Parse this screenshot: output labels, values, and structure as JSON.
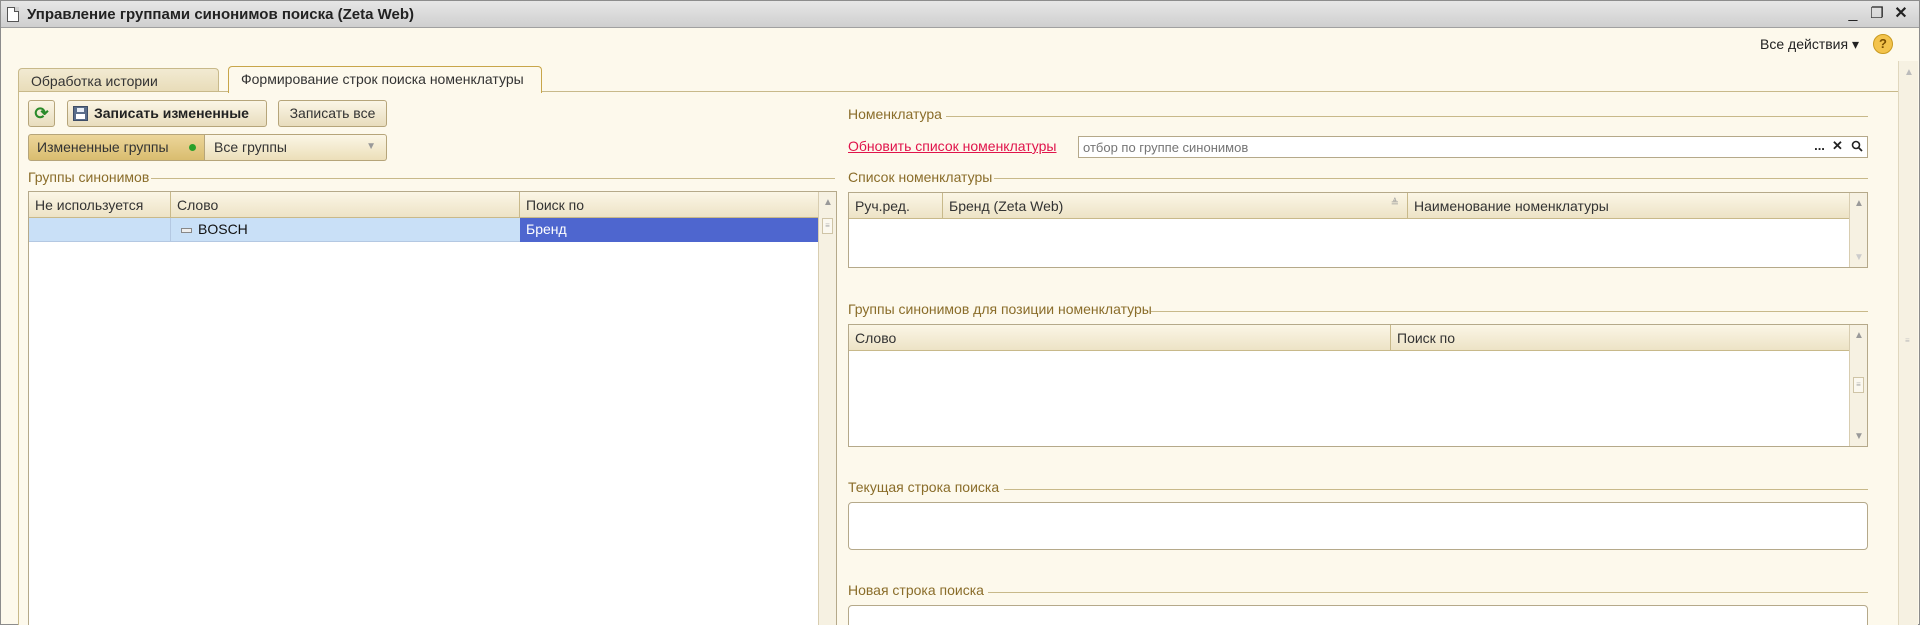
{
  "window": {
    "title": "Управление группами синонимов поиска (Zeta Web)",
    "controls": {
      "minimize": "_",
      "restore": "❐",
      "close": "✕"
    }
  },
  "toolbar": {
    "all_actions": "Все действия ▾",
    "help": "?"
  },
  "tabs": [
    {
      "label": "Обработка истории поиска",
      "active": false
    },
    {
      "label": "Формирование строк поиска номенклатуры",
      "active": true
    }
  ],
  "left": {
    "refresh_icon": "refresh-icon",
    "save_changed_label": "Записать измененные",
    "save_all_label": "Записать все",
    "filter_changed": "Измененные группы",
    "filter_all": "Все группы",
    "synonym_groups_title": "Группы синонимов",
    "grid": {
      "columns": [
        "Не используется",
        "Слово",
        "Поиск по"
      ],
      "rows": [
        {
          "unused": "",
          "word": "BOSCH",
          "search_by": "Бренд"
        }
      ]
    }
  },
  "right": {
    "nomenclature_title": "Номенклатура",
    "refresh_link": "Обновить список номенклатуры",
    "filter_placeholder": "отбор по группе синонимов",
    "input_buttons": {
      "choose": "...",
      "clear": "✕",
      "search": "search-icon"
    },
    "nomenclature_list_title": "Список номенклатуры",
    "nomenclature_grid": {
      "columns": [
        "Руч.ред.",
        "Бренд (Zeta Web)",
        "Наименование номенклатуры"
      ]
    },
    "synonym_groups_position_title": "Группы синонимов для позиции номенклатуры",
    "synonym_grid": {
      "columns": [
        "Слово",
        "Поиск по"
      ]
    },
    "current_search_title": "Текущая строка поиска",
    "new_search_title": "Новая строка поиска"
  },
  "colors": {
    "accent_label": "#8a6d2a",
    "link": "#e0144b",
    "selection": "#4e66cf",
    "row_highlight": "#c9e0f7"
  }
}
